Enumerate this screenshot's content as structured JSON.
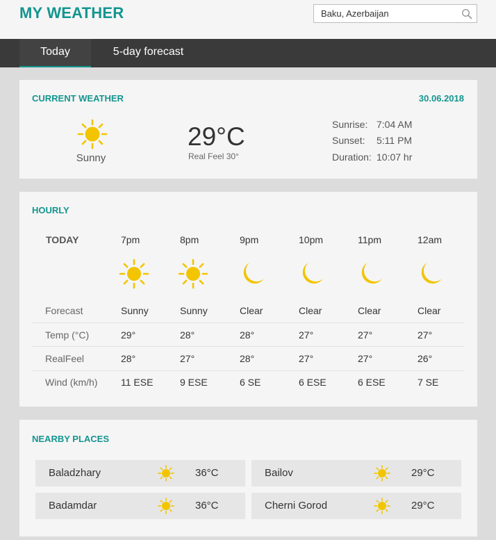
{
  "app": {
    "title": "MY WEATHER"
  },
  "search": {
    "value": "Baku, Azerbaijan",
    "icon": "search-icon"
  },
  "nav": {
    "tabs": [
      {
        "label": "Today",
        "active": true
      },
      {
        "label": "5-day forecast",
        "active": false
      }
    ]
  },
  "colors": {
    "accent": "#13958f",
    "sun": "#f2c500",
    "nav": "#3a3a3a"
  },
  "current": {
    "title": "CURRENT WEATHER",
    "date": "30.06.2018",
    "icon": "sun-icon",
    "condition": "Sunny",
    "temp": "29°C",
    "real_feel": "Real Feel 30°",
    "sunrise_label": "Sunrise:",
    "sunrise": "7:04 AM",
    "sunset_label": "Sunset:",
    "sunset": "5:11 PM",
    "duration_label": "Duration:",
    "duration": "10:07 hr"
  },
  "hourly": {
    "title": "HOURLY",
    "today_label": "TODAY",
    "row_labels": {
      "forecast": "Forecast",
      "temp": "Temp (°C)",
      "realfeel": "RealFeel",
      "wind": "Wind (km/h)"
    },
    "hours": [
      {
        "time": "7pm",
        "icon": "sun-icon",
        "forecast": "Sunny",
        "temp": "29°",
        "realfeel": "28°",
        "wind": "11 ESE"
      },
      {
        "time": "8pm",
        "icon": "sun-icon",
        "forecast": "Sunny",
        "temp": "28°",
        "realfeel": "27°",
        "wind": "9 ESE"
      },
      {
        "time": "9pm",
        "icon": "moon-icon",
        "forecast": "Clear",
        "temp": "28°",
        "realfeel": "28°",
        "wind": "6 SE"
      },
      {
        "time": "10pm",
        "icon": "moon-icon",
        "forecast": "Clear",
        "temp": "27°",
        "realfeel": "27°",
        "wind": "6 ESE"
      },
      {
        "time": "11pm",
        "icon": "moon-icon",
        "forecast": "Clear",
        "temp": "27°",
        "realfeel": "27°",
        "wind": "6 ESE"
      },
      {
        "time": "12am",
        "icon": "moon-icon",
        "forecast": "Clear",
        "temp": "27°",
        "realfeel": "26°",
        "wind": "7 SE"
      }
    ]
  },
  "nearby": {
    "title": "NEARBY PLACES",
    "places": [
      {
        "name": "Baladzhary",
        "icon": "sun-icon",
        "temp": "36°C"
      },
      {
        "name": "Bailov",
        "icon": "sun-icon",
        "temp": "29°C"
      },
      {
        "name": "Badamdar",
        "icon": "sun-icon",
        "temp": "36°C"
      },
      {
        "name": "Cherni Gorod",
        "icon": "sun-icon",
        "temp": "29°C"
      }
    ]
  }
}
